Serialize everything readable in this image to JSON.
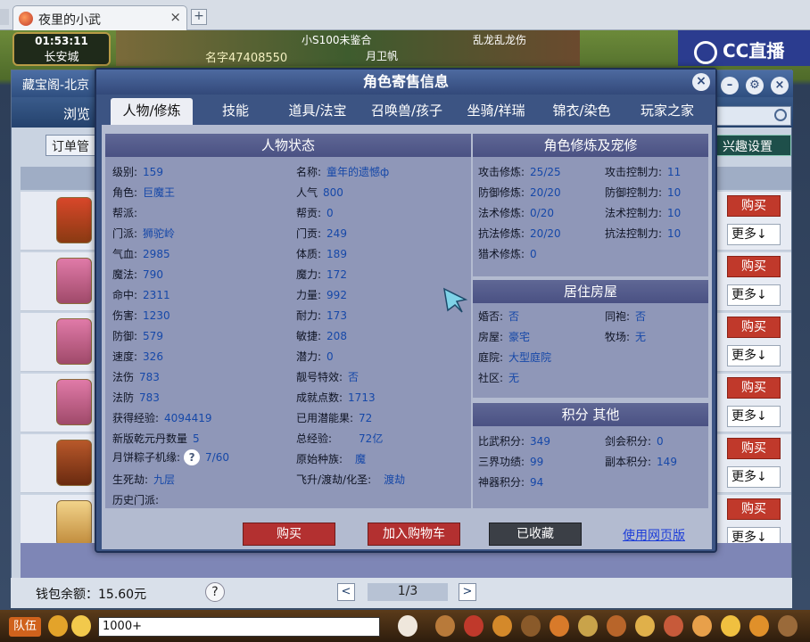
{
  "browser": {
    "tab_title": "夜里的小武",
    "tab_close": "×",
    "new_tab": "+"
  },
  "game": {
    "time": "01:53:11",
    "location": "长安城",
    "top_text_1": "小S100未鉴合",
    "top_text_2": "乱龙乱龙伤",
    "top_text_3": "名字47408550",
    "top_text_4": "月卫帆",
    "cc_brand": "CC直播"
  },
  "bg_window": {
    "title": "藏宝阁-北京",
    "nav_browse": "浏览",
    "order_btn": "订单管",
    "interest_btn": "兴趣设置",
    "buy_label": "购买",
    "more_label": "更多↓",
    "wallet": "钱包余额：15.60元",
    "help": "?",
    "page": "1/3",
    "prev": "<",
    "next": ">"
  },
  "taskbar": {
    "team": "队伍",
    "chat_input": "1000+"
  },
  "modal": {
    "title": "角色寄售信息",
    "close": "×",
    "tabs": [
      "人物/修炼",
      "技能",
      "道具/法宝",
      "召唤兽/孩子",
      "坐骑/祥瑞",
      "锦衣/染色",
      "玩家之家"
    ],
    "status": {
      "heading": "人物状态",
      "left": [
        {
          "k": "级别:",
          "v": "159"
        },
        {
          "k": "角色:",
          "v": "巨魔王"
        },
        {
          "k": "帮派:",
          "v": ""
        },
        {
          "k": "门派:",
          "v": "狮驼岭"
        },
        {
          "k": "气血:",
          "v": "2985"
        },
        {
          "k": "魔法:",
          "v": "790"
        },
        {
          "k": "命中:",
          "v": "2311"
        },
        {
          "k": "伤害:",
          "v": "1230"
        },
        {
          "k": "防御:",
          "v": "579"
        },
        {
          "k": "速度:",
          "v": "326"
        },
        {
          "k": "法伤",
          "v": "783"
        },
        {
          "k": "法防",
          "v": "783"
        },
        {
          "k": "获得经验:",
          "v": "4094419"
        },
        {
          "k": "新版乾元丹数量",
          "v": "5"
        },
        {
          "k": "月饼粽子机缘:",
          "v": "7/60"
        },
        {
          "k": "生死劫:",
          "v": "九层"
        },
        {
          "k": "历史门派:",
          "v": ""
        }
      ],
      "right": [
        {
          "k": "名称:",
          "v": "童年的遗憾ф"
        },
        {
          "k": "人气",
          "v": "800"
        },
        {
          "k": "帮贡:",
          "v": "0"
        },
        {
          "k": "门贡:",
          "v": "249"
        },
        {
          "k": "体质:",
          "v": "189"
        },
        {
          "k": "魔力:",
          "v": "172"
        },
        {
          "k": "力量:",
          "v": "992"
        },
        {
          "k": "耐力:",
          "v": "173"
        },
        {
          "k": "敏捷:",
          "v": "208"
        },
        {
          "k": "潜力:",
          "v": "0"
        },
        {
          "k": "靓号特效:",
          "v": "否"
        },
        {
          "k": "成就点数:",
          "v": "1713"
        },
        {
          "k": "已用潜能果:",
          "v": "72"
        },
        {
          "k": "总经验:",
          "v": "72亿"
        },
        {
          "k": "原始种族:",
          "v": "魔"
        },
        {
          "k": "飞升/渡劫/化圣:",
          "v": "渡劫"
        }
      ],
      "help": "?"
    },
    "cultivation": {
      "heading": "角色修炼及宠修",
      "left": [
        {
          "k": "攻击修炼:",
          "v": "25/25"
        },
        {
          "k": "防御修炼:",
          "v": "20/20"
        },
        {
          "k": "法术修炼:",
          "v": "0/20"
        },
        {
          "k": "抗法修炼:",
          "v": "20/20"
        },
        {
          "k": "猎术修炼:",
          "v": "0"
        }
      ],
      "right": [
        {
          "k": "攻击控制力:",
          "v": "11"
        },
        {
          "k": "防御控制力:",
          "v": "10"
        },
        {
          "k": "法术控制力:",
          "v": "10"
        },
        {
          "k": "抗法控制力:",
          "v": "10"
        }
      ]
    },
    "house": {
      "heading": "居住房屋",
      "left": [
        {
          "k": "婚否:",
          "v": "否"
        },
        {
          "k": "房屋:",
          "v": "豪宅"
        },
        {
          "k": "庭院:",
          "v": "大型庭院"
        },
        {
          "k": "社区:",
          "v": "无"
        }
      ],
      "right": [
        {
          "k": "同袍:",
          "v": "否"
        },
        {
          "k": "牧场:",
          "v": "无"
        }
      ]
    },
    "points": {
      "heading": "积分 其他",
      "left": [
        {
          "k": "比武积分:",
          "v": "349"
        },
        {
          "k": "三界功绩:",
          "v": "99"
        },
        {
          "k": "神器积分:",
          "v": "94"
        }
      ],
      "right": [
        {
          "k": "剑会积分:",
          "v": "0"
        },
        {
          "k": "副本积分:",
          "v": "149"
        }
      ]
    },
    "buttons": {
      "buy": "购买",
      "cart": "加入购物车",
      "fav": "已收藏",
      "web": "使用网页版"
    }
  },
  "colors": {
    "accent_red": "#b33030",
    "value_blue": "#1648a8"
  }
}
